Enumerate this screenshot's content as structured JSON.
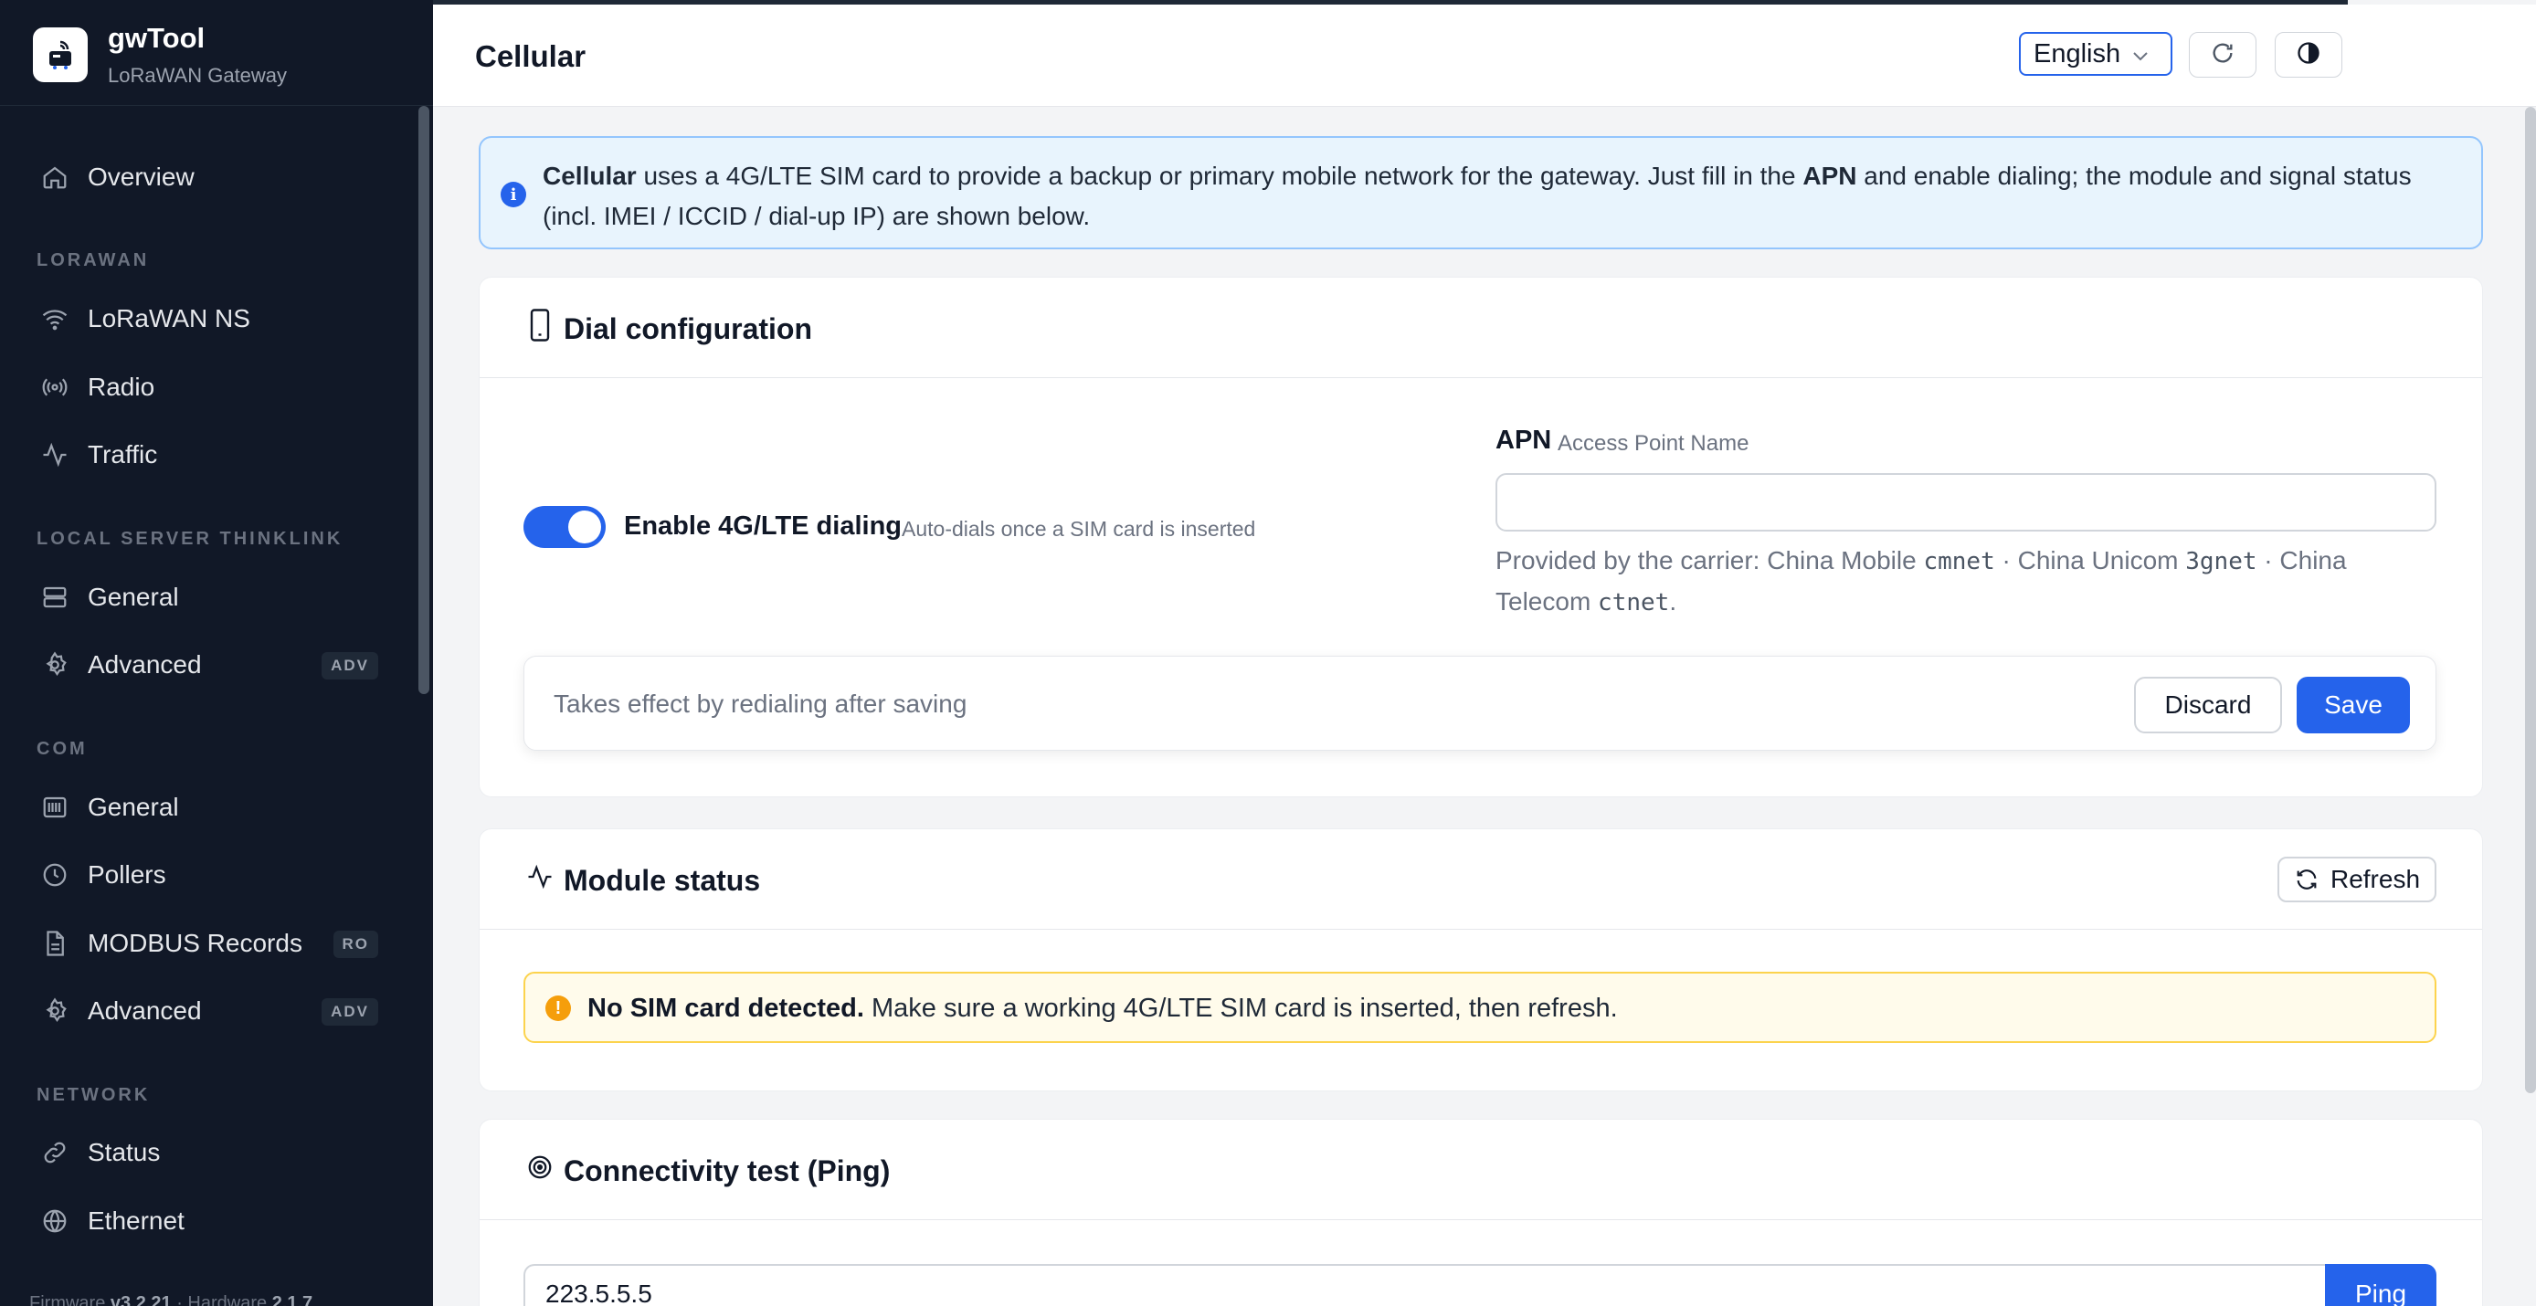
{
  "brand": {
    "name": "gwTool",
    "subtitle": "LoRaWAN Gateway",
    "logo_icon": "gateway-icon"
  },
  "sidebar": {
    "overview": {
      "label": "Overview",
      "icon": "home-icon"
    },
    "sections": {
      "lorawan": "LORAWAN",
      "local_server": "LOCAL SERVER THINKLINK",
      "com": "COM",
      "network": "NETWORK"
    },
    "lorawan_items": [
      {
        "label": "LoRaWAN NS",
        "icon": "wifi-icon"
      },
      {
        "label": "Radio",
        "icon": "radio-icon"
      },
      {
        "label": "Traffic",
        "icon": "activity-icon"
      }
    ],
    "local_items": [
      {
        "label": "General",
        "icon": "server-icon"
      },
      {
        "label": "Advanced",
        "icon": "gear-icon",
        "badge": "ADV"
      }
    ],
    "com_items": [
      {
        "label": "General",
        "icon": "serial-icon"
      },
      {
        "label": "Pollers",
        "icon": "clock-icon"
      },
      {
        "label": "MODBUS Records",
        "icon": "document-icon",
        "badge": "RO"
      },
      {
        "label": "Advanced",
        "icon": "gear-icon",
        "badge": "ADV"
      }
    ],
    "network_items": [
      {
        "label": "Status",
        "icon": "link-icon"
      },
      {
        "label": "Ethernet",
        "icon": "globe-icon"
      }
    ],
    "footer": {
      "firmware_label": "Firmware",
      "firmware": "v3.2.21",
      "hardware_label": "Hardware",
      "hardware": "2.1.7"
    }
  },
  "header": {
    "title": "Cellular",
    "language": "English"
  },
  "info": {
    "strong1": "Cellular",
    "text1": " uses a 4G/LTE SIM card to provide a backup or primary mobile network for the gateway. Just fill in the ",
    "strong2": "APN",
    "text2": " and enable dialing; the module and signal status (incl. IMEI / ICCID / dial-up IP) are shown below."
  },
  "dial": {
    "title": "Dial configuration",
    "toggle_label": "Enable 4G/LTE dialing",
    "toggle_hint": "Auto-dials once a SIM card is inserted",
    "toggle_on": true,
    "apn_label": "APN",
    "apn_sub": "Access Point Name",
    "apn_value": "",
    "apn_help_1": "Provided by the carrier: China Mobile ",
    "apn_code_1": "cmnet",
    "apn_help_2": " · China Unicom ",
    "apn_code_2": "3gnet",
    "apn_help_3": " · China Telecom ",
    "apn_code_3": "ctnet",
    "apn_help_4": ".",
    "save_hint": "Takes effect by redialing after saving",
    "discard": "Discard",
    "save": "Save"
  },
  "module": {
    "title": "Module status",
    "refresh": "Refresh",
    "warn_strong": "No SIM card detected.",
    "warn_text": " Make sure a working 4G/LTE SIM card is inserted, then refresh."
  },
  "ping": {
    "title": "Connectivity test (Ping)",
    "target": "223.5.5.5",
    "button": "Ping"
  }
}
